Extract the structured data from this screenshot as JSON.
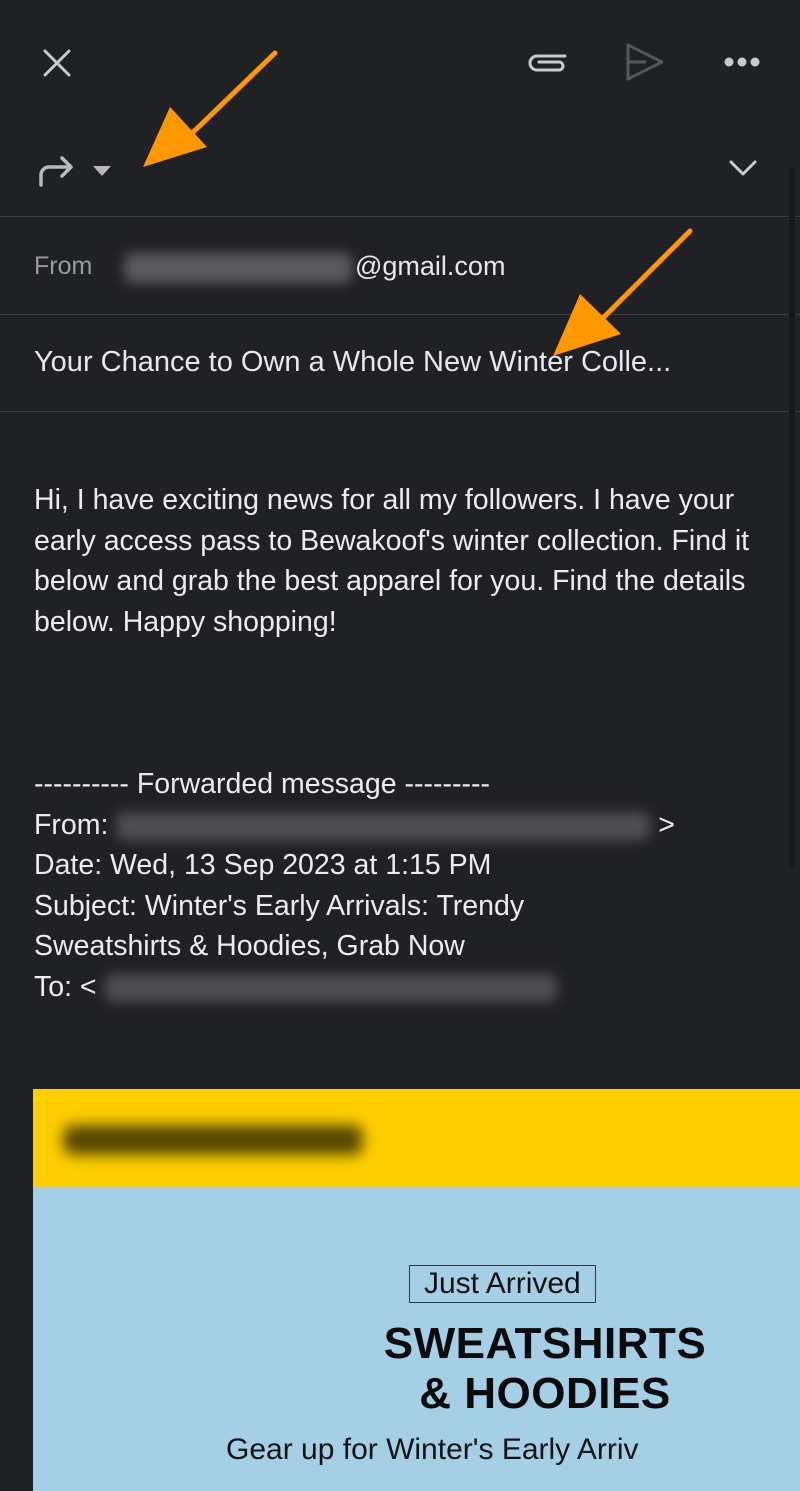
{
  "toolbar": {
    "close_icon": "close-icon",
    "attach_icon": "paperclip-icon",
    "send_icon": "send-icon",
    "more_icon": "more-horizontal-icon"
  },
  "compose_mode": {
    "icon": "forward-arrow-icon",
    "dropdown_icon": "caret-down-icon",
    "expand_icon": "chevron-down-icon"
  },
  "header": {
    "from_label": "From",
    "from_address_suffix": "@gmail.com",
    "subject": "Your Chance to Own a Whole New Winter Colle..."
  },
  "body": {
    "message": "Hi, I have exciting news for all my followers. I have your early access pass to Bewakoof's winter collection. Find it below and grab the best apparel for you. Find the details below. Happy shopping!",
    "forwarded": {
      "divider": "---------- Forwarded message ---------",
      "from_label": "From:",
      "from_suffix": ">",
      "date_line": "Date: Wed, 13 Sep 2023 at 1:15 PM",
      "subject_line_1": "Subject: Winter's Early Arrivals: Trendy",
      "subject_line_2": "Sweatshirts & Hoodies, Grab Now",
      "to_label": "To: <"
    }
  },
  "banner": {
    "badge": "Just Arrived",
    "headline_1": "SWEATSHIRTS",
    "headline_2": "& HOODIES",
    "tagline": "Gear up for Winter's Early Arriv",
    "colors": {
      "top": "#fdce00",
      "main": "#a4cfe4"
    }
  },
  "annotations": {
    "arrow_color": "#ff9800",
    "count": 2
  }
}
